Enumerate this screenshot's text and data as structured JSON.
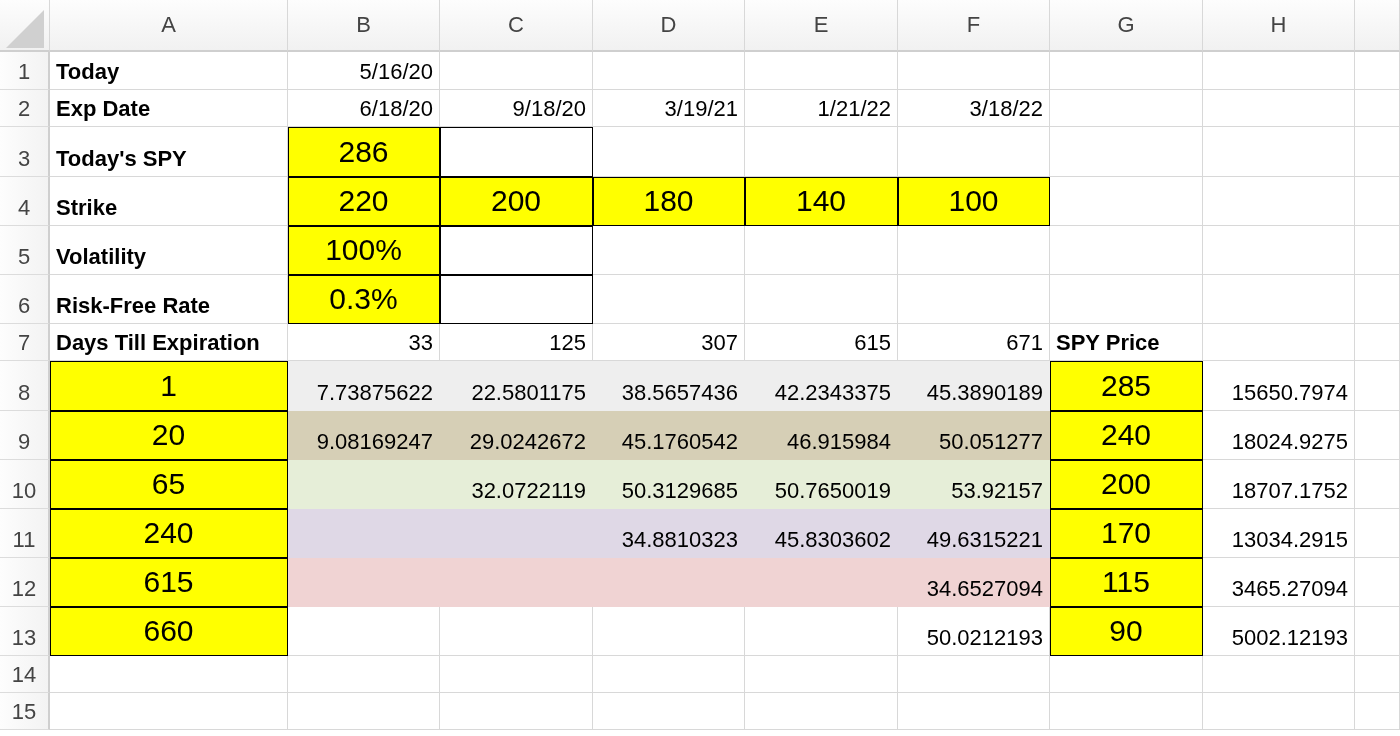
{
  "columns": [
    "A",
    "B",
    "C",
    "D",
    "E",
    "F",
    "G",
    "H"
  ],
  "rows": [
    {
      "number": "1",
      "cells": [
        {
          "kind": "label",
          "text": "Today"
        },
        {
          "kind": "value",
          "text": "5/16/20"
        },
        {
          "kind": "empty"
        },
        {
          "kind": "empty"
        },
        {
          "kind": "empty"
        },
        {
          "kind": "empty"
        },
        {
          "kind": "empty"
        },
        {
          "kind": "empty"
        }
      ]
    },
    {
      "number": "2",
      "cells": [
        {
          "kind": "label",
          "text": "Exp Date"
        },
        {
          "kind": "value",
          "text": "6/18/20"
        },
        {
          "kind": "value",
          "text": "9/18/20"
        },
        {
          "kind": "value",
          "text": "3/19/21"
        },
        {
          "kind": "value",
          "text": "1/21/22"
        },
        {
          "kind": "value",
          "text": "3/18/22"
        },
        {
          "kind": "empty"
        },
        {
          "kind": "empty"
        }
      ]
    },
    {
      "number": "3",
      "cells": [
        {
          "kind": "label",
          "text": "Today's SPY"
        },
        {
          "kind": "input",
          "text": "286"
        },
        {
          "kind": "box"
        },
        {
          "kind": "empty"
        },
        {
          "kind": "empty"
        },
        {
          "kind": "empty"
        },
        {
          "kind": "empty"
        },
        {
          "kind": "empty"
        }
      ]
    },
    {
      "number": "4",
      "cells": [
        {
          "kind": "label",
          "text": "Strike"
        },
        {
          "kind": "input",
          "text": "220"
        },
        {
          "kind": "input",
          "text": "200"
        },
        {
          "kind": "input",
          "text": "180"
        },
        {
          "kind": "input",
          "text": "140"
        },
        {
          "kind": "input",
          "text": "100"
        },
        {
          "kind": "empty"
        },
        {
          "kind": "empty"
        }
      ]
    },
    {
      "number": "5",
      "cells": [
        {
          "kind": "label",
          "text": "Volatility"
        },
        {
          "kind": "input",
          "text": "100%"
        },
        {
          "kind": "box"
        },
        {
          "kind": "empty"
        },
        {
          "kind": "empty"
        },
        {
          "kind": "empty"
        },
        {
          "kind": "empty"
        },
        {
          "kind": "empty"
        }
      ]
    },
    {
      "number": "6",
      "cells": [
        {
          "kind": "label",
          "text": "Risk-Free Rate"
        },
        {
          "kind": "input",
          "text": "0.3%"
        },
        {
          "kind": "box"
        },
        {
          "kind": "empty"
        },
        {
          "kind": "empty"
        },
        {
          "kind": "empty"
        },
        {
          "kind": "empty"
        },
        {
          "kind": "empty"
        }
      ]
    },
    {
      "number": "7",
      "cells": [
        {
          "kind": "label",
          "text": "Days Till Expiration"
        },
        {
          "kind": "value",
          "text": "33"
        },
        {
          "kind": "value",
          "text": "125"
        },
        {
          "kind": "value",
          "text": "307"
        },
        {
          "kind": "value",
          "text": "615"
        },
        {
          "kind": "value",
          "text": "671"
        },
        {
          "kind": "label",
          "text": "SPY Price"
        },
        {
          "kind": "empty"
        }
      ]
    },
    {
      "number": "8",
      "color": "#eeeeee",
      "cells": [
        {
          "kind": "input",
          "text": "1"
        },
        {
          "kind": "value",
          "text": "7.73875622"
        },
        {
          "kind": "value",
          "text": "22.5801175"
        },
        {
          "kind": "value",
          "text": "38.5657436"
        },
        {
          "kind": "value",
          "text": "42.2343375"
        },
        {
          "kind": "value",
          "text": "45.3890189"
        },
        {
          "kind": "input",
          "text": "285"
        },
        {
          "kind": "value",
          "text": "15650.7974"
        }
      ]
    },
    {
      "number": "9",
      "color": "#d6cfb6",
      "cells": [
        {
          "kind": "input",
          "text": "20"
        },
        {
          "kind": "value",
          "text": "9.08169247"
        },
        {
          "kind": "value",
          "text": "29.0242672"
        },
        {
          "kind": "value",
          "text": "45.1760542"
        },
        {
          "kind": "value",
          "text": "46.915984"
        },
        {
          "kind": "value",
          "text": "50.051277"
        },
        {
          "kind": "input",
          "text": "240"
        },
        {
          "kind": "value",
          "text": "18024.9275"
        }
      ]
    },
    {
      "number": "10",
      "color": "#e6eed8",
      "cells": [
        {
          "kind": "input",
          "text": "65"
        },
        {
          "kind": "empty"
        },
        {
          "kind": "value",
          "text": "32.0722119"
        },
        {
          "kind": "value",
          "text": "50.3129685"
        },
        {
          "kind": "value",
          "text": "50.7650019"
        },
        {
          "kind": "value",
          "text": "53.92157"
        },
        {
          "kind": "input",
          "text": "200"
        },
        {
          "kind": "value",
          "text": "18707.1752"
        }
      ]
    },
    {
      "number": "11",
      "color": "#dfd8e6",
      "cells": [
        {
          "kind": "input",
          "text": "240"
        },
        {
          "kind": "empty"
        },
        {
          "kind": "empty"
        },
        {
          "kind": "value",
          "text": "34.8810323"
        },
        {
          "kind": "value",
          "text": "45.8303602"
        },
        {
          "kind": "value",
          "text": "49.6315221"
        },
        {
          "kind": "input",
          "text": "170"
        },
        {
          "kind": "value",
          "text": "13034.2915"
        }
      ]
    },
    {
      "number": "12",
      "color": "#f0d3d3",
      "cells": [
        {
          "kind": "input",
          "text": "615"
        },
        {
          "kind": "empty"
        },
        {
          "kind": "empty"
        },
        {
          "kind": "empty"
        },
        {
          "kind": "empty"
        },
        {
          "kind": "value",
          "text": "34.6527094"
        },
        {
          "kind": "input",
          "text": "115"
        },
        {
          "kind": "value",
          "text": "3465.27094"
        }
      ]
    },
    {
      "number": "13",
      "cells": [
        {
          "kind": "input",
          "text": "660"
        },
        {
          "kind": "empty"
        },
        {
          "kind": "empty"
        },
        {
          "kind": "empty"
        },
        {
          "kind": "empty"
        },
        {
          "kind": "value",
          "text": "50.0212193"
        },
        {
          "kind": "input",
          "text": "90"
        },
        {
          "kind": "value",
          "text": "5002.12193"
        }
      ]
    },
    {
      "number": "14",
      "cells": []
    },
    {
      "number": "15",
      "cells": []
    }
  ]
}
